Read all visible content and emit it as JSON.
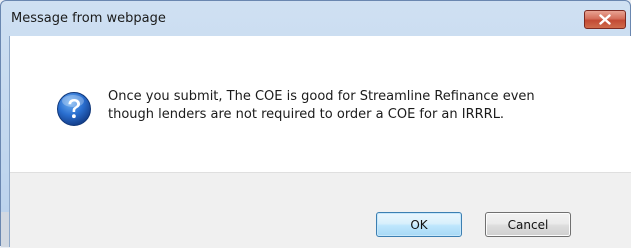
{
  "window": {
    "title": "Message from webpage",
    "close_icon": "close-icon"
  },
  "dialog": {
    "icon": "question-icon",
    "message_line1": "Once you submit, The COE is good for Streamline Refinance even",
    "message_line2": "though lenders are not required to order a COE for an IRRRL."
  },
  "buttons": {
    "ok_label": "OK",
    "cancel_label": "Cancel"
  },
  "colors": {
    "title_bar": "#c6dbf1",
    "close_button": "#c94b35",
    "icon_blue": "#1f5fb6"
  }
}
